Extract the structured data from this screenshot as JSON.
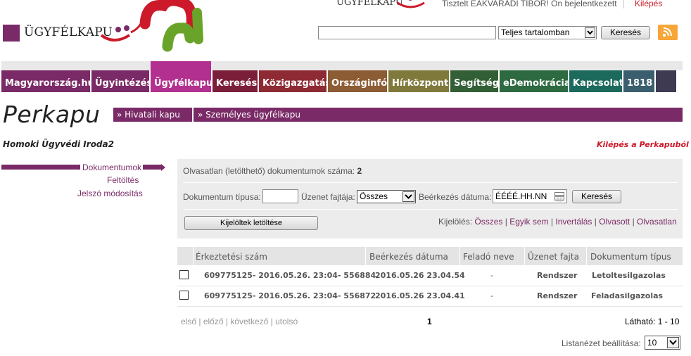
{
  "header": {
    "logo_text": "ÜGYFÉLKAPU",
    "top_logo_text": "ÜGYFÉLKAPU",
    "greeting": "Tisztelt EAKVARADI TIBOR! Ön bejelentkezett",
    "logout": "Kilépés",
    "search_value": "",
    "search_scope": "Teljes tartalomban",
    "search_button": "Keresés",
    "colors": {
      "brand": "#7a2a66",
      "logout": "#cc1a2a",
      "rss": "#f7a637"
    }
  },
  "nav": [
    {
      "label": "Magyarország.hu",
      "color": "#7a2a66",
      "width": 126
    },
    {
      "label": "Ügyintézés",
      "color": "#7a2a66",
      "width": 82
    },
    {
      "label": "Ügyfélkapu",
      "color": "#b2308f",
      "width": 86,
      "active": true
    },
    {
      "label": "Keresés",
      "color": "#7b1e39",
      "width": 64
    },
    {
      "label": "Közigazgatás",
      "color": "#8e2a33",
      "width": 96
    },
    {
      "label": "Országinfó",
      "color": "#8c5c34",
      "width": 84
    },
    {
      "label": "Hírközpont",
      "color": "#7f7a3c",
      "width": 86
    },
    {
      "label": "Segítség",
      "color": "#325f35",
      "width": 68
    },
    {
      "label": "eDemokrácia",
      "color": "#2e6a41",
      "width": 97
    },
    {
      "label": "Kapcsolat",
      "color": "#1c6a5b",
      "width": 75
    },
    {
      "label": "1818",
      "color": "#3b5e6f",
      "width": 44
    },
    {
      "label": "",
      "color": "#3e3a52",
      "width": 29
    }
  ],
  "page": {
    "title": "Perkapu",
    "portal_links": [
      "Hivatali kapu",
      "Személyes ügyfélkapu"
    ],
    "org_name": "Homoki Ügyvédi Iroda2",
    "exit_portal": "Kilépés a Perkapuból"
  },
  "left_menu": {
    "active": "Dokumentumok",
    "items": [
      "Feltöltés",
      "Jelszó módosítás"
    ]
  },
  "filters": {
    "unread_label": "Olvasatlan (letölthető) dokumentumok száma:",
    "unread_count": "2",
    "doc_type_label": "Dokumentum típusa:",
    "doc_type_value": "",
    "msg_type_label": "Üzenet fajtája:",
    "msg_type_value": "Összes",
    "date_label": "Beérkezés dátuma:",
    "date_value": "ÉÉÉÉ.HH.NN",
    "search_button": "Keresés",
    "download_button": "Kijelöltek letöltése",
    "selection_label": "Kijelölés:",
    "selection_links": [
      "Összes",
      "Egyik sem",
      "Invertálás",
      "Olvasott",
      "Olvasatlan"
    ]
  },
  "table": {
    "headers": [
      "Érkeztetési szám",
      "Beérkezés dátuma",
      "Feladó neve",
      "Üzenet fajta",
      "Dokumentum típus"
    ],
    "rows": [
      [
        "609775125- 2016.05.26. 23:04- 556884",
        "2016.05.26 23.04.54",
        "-",
        "Rendszer",
        "Letoltesilgazolas"
      ],
      [
        "609775125- 2016.05.26. 23:04- 556872",
        "2016.05.26 23.04.41",
        "-",
        "Rendszer",
        "Feladasilgazolas"
      ]
    ]
  },
  "pager": {
    "first": "első",
    "prev": "előző",
    "next": "következő",
    "last": "utolsó",
    "current": "1",
    "visible": "Látható: 1 - 10",
    "list_view_label": "Listanézet beállítása:",
    "list_view_value": "10"
  }
}
